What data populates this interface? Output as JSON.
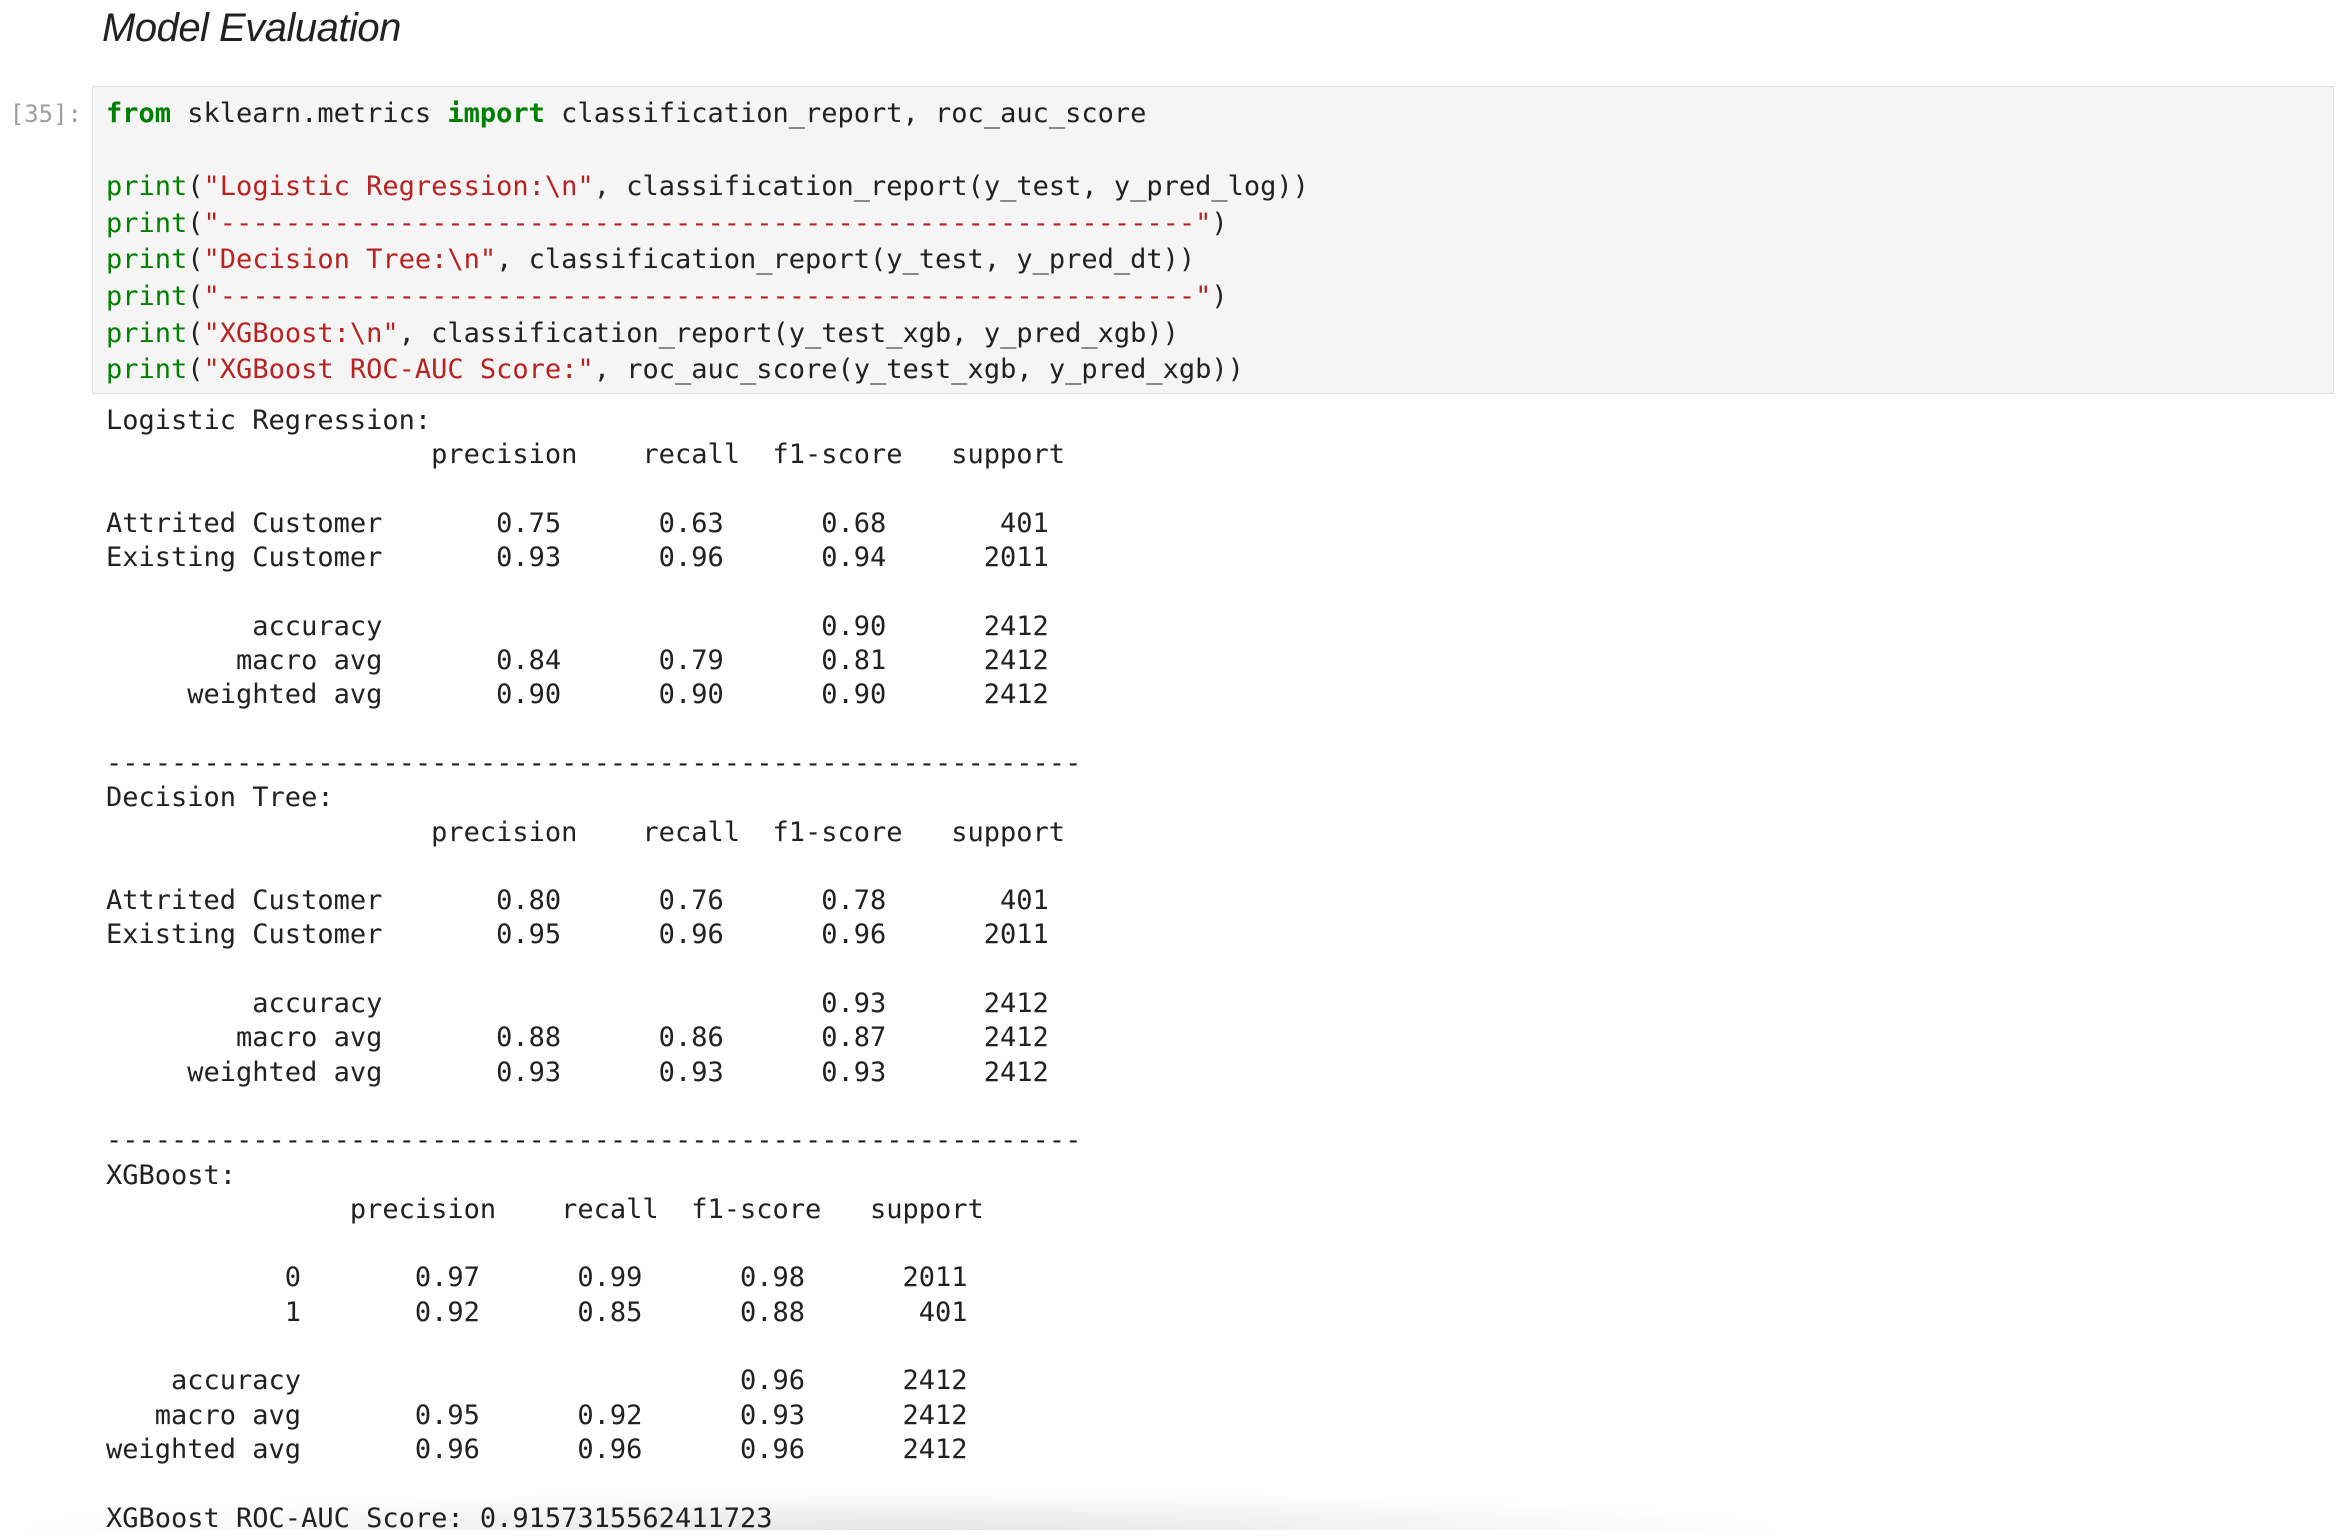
{
  "section_title": "Model Evaluation",
  "cell": {
    "prompt": "[35]:",
    "code": {
      "import_kw_from": "from",
      "import_module": " sklearn.metrics ",
      "import_kw_import": "import",
      "import_names": " classification_report, roc_auc_score",
      "lines": [
        {
          "fn": "print",
          "open": "(",
          "str": "\"Logistic Regression:\\n\"",
          "rest": ", classification_report(y_test, y_pred_log))"
        },
        {
          "fn": "print",
          "open": "(",
          "str": "\"------------------------------------------------------------\"",
          "rest": ")"
        },
        {
          "fn": "print",
          "open": "(",
          "str": "\"Decision Tree:\\n\"",
          "rest": ", classification_report(y_test, y_pred_dt))"
        },
        {
          "fn": "print",
          "open": "(",
          "str": "\"------------------------------------------------------------\"",
          "rest": ")"
        },
        {
          "fn": "print",
          "open": "(",
          "str": "\"XGBoost:\\n\"",
          "rest": ", classification_report(y_test_xgb, y_pred_xgb))"
        },
        {
          "fn": "print",
          "open": "(",
          "str": "\"XGBoost ROC-AUC Score:\"",
          "rest": ", roc_auc_score(y_test_xgb, y_pred_xgb))"
        }
      ]
    },
    "output_text": "Logistic Regression:\n                    precision    recall  f1-score   support\n\nAttrited Customer       0.75      0.63      0.68       401\nExisting Customer       0.93      0.96      0.94      2011\n\n         accuracy                           0.90      2412\n        macro avg       0.84      0.79      0.81      2412\n     weighted avg       0.90      0.90      0.90      2412\n\n------------------------------------------------------------\nDecision Tree:\n                    precision    recall  f1-score   support\n\nAttrited Customer       0.80      0.76      0.78       401\nExisting Customer       0.95      0.96      0.96      2011\n\n         accuracy                           0.93      2412\n        macro avg       0.88      0.86      0.87      2412\n     weighted avg       0.93      0.93      0.93      2412\n\n------------------------------------------------------------\nXGBoost:\n               precision    recall  f1-score   support\n\n           0       0.97      0.99      0.98      2011\n           1       0.92      0.85      0.88       401\n\n    accuracy                           0.96      2412\n   macro avg       0.95      0.92      0.93      2412\nweighted avg       0.96      0.96      0.96      2412\n\nXGBoost ROC-AUC Score: 0.9157315562411723"
  }
}
